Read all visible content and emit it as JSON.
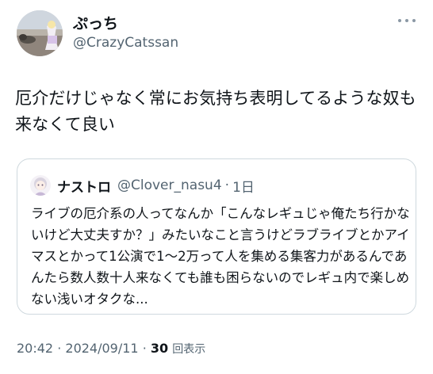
{
  "author": {
    "display_name": "ぷっち",
    "handle": "@CrazyCatssan"
  },
  "tweet": {
    "text": "厄介だけじゃなく常にお気持ち表明してるような奴も来なくて良い"
  },
  "quoted": {
    "name": "ナストロ",
    "handle": "@Clover_nasu4",
    "separator": "·",
    "time": "1日",
    "text": "ライブの厄介系の人ってなんか「こんなレギュじゃ俺たち行かないけど大丈夫すか？」みたいなこと言うけどラブライブとかアイマスとかって1公演で1〜2万って人を集める集客力があるんであんたら数人数十人来なくても誰も困らないのでレギュ内で楽しめない浅いオタクな..."
  },
  "meta": {
    "time": "20:42",
    "separator": "·",
    "date": "2024/09/11",
    "views_count": "30",
    "views_label": "回表示"
  },
  "icons": {
    "more": "more-horizontal-icon"
  },
  "colors": {
    "text": "#0f1419",
    "secondary": "#536471",
    "border": "#cfd9de"
  }
}
